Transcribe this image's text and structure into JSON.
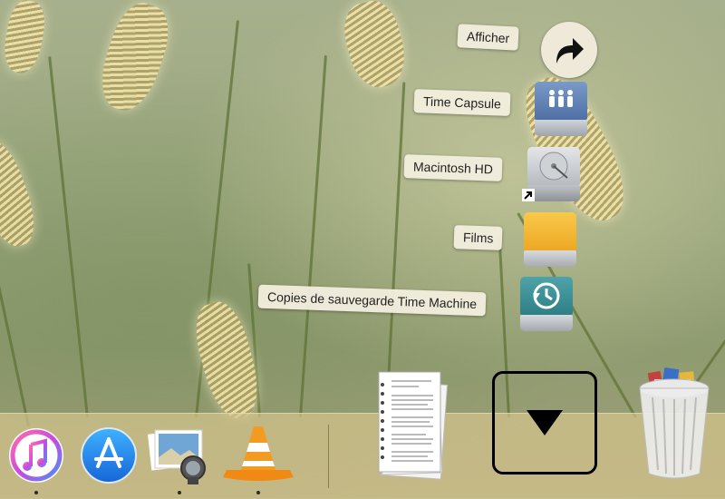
{
  "stack_menu": {
    "items": [
      {
        "label": "Afficher",
        "icon": "forward-arrow-icon"
      },
      {
        "label": "Time Capsule",
        "icon": "time-capsule-drive-icon"
      },
      {
        "label": "Macintosh HD",
        "icon": "hard-drive-icon"
      },
      {
        "label": "Films",
        "icon": "yellow-drive-icon"
      },
      {
        "label": "Copies de sauvegarde Time Machine",
        "icon": "time-machine-drive-icon"
      }
    ]
  },
  "dock": {
    "apps": [
      {
        "name": "iTunes",
        "icon": "itunes-icon",
        "running": true
      },
      {
        "name": "App Store",
        "icon": "app-store-icon",
        "running": false
      },
      {
        "name": "Preview",
        "icon": "preview-icon",
        "running": true
      },
      {
        "name": "VLC",
        "icon": "vlc-icon",
        "running": true
      }
    ],
    "stacks": [
      {
        "name": "Documents",
        "icon": "documents-stack-icon"
      },
      {
        "name": "Volumes",
        "icon": "stack-down-arrow-icon"
      },
      {
        "name": "Trash",
        "icon": "trash-icon"
      }
    ]
  },
  "colors": {
    "itunes": "#e0479a",
    "app_store": "#1e8ff0",
    "vlc": "#f08a1c",
    "films_drive": "#f5b62e",
    "time_machine_drive": "#3b8a90"
  }
}
